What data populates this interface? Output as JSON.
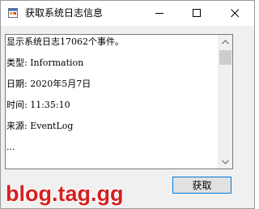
{
  "window": {
    "title": "获取系统日志信息"
  },
  "titlebar": {
    "icons": {
      "app": "app-window-icon",
      "minimize": "minimize-icon",
      "maximize": "maximize-icon",
      "close": "close-icon"
    }
  },
  "log_text": {
    "lines": [
      "显示系统日志17062个事件。",
      "",
      "类型: Information",
      "",
      "日期: 2020年5月7日",
      "",
      "时间: 11:35:10",
      "",
      "来源: EventLog",
      "",
      "..."
    ]
  },
  "scrollbar": {
    "up_icon": "scroll-up-arrow-icon",
    "down_icon": "scroll-down-arrow-icon"
  },
  "buttons": {
    "fetch_label": "获取"
  },
  "watermark": {
    "text": "blog.tag.gg"
  },
  "colors": {
    "accent": "#0078d7",
    "watermark": "#d42020",
    "window_bg": "#f0f0f0"
  }
}
